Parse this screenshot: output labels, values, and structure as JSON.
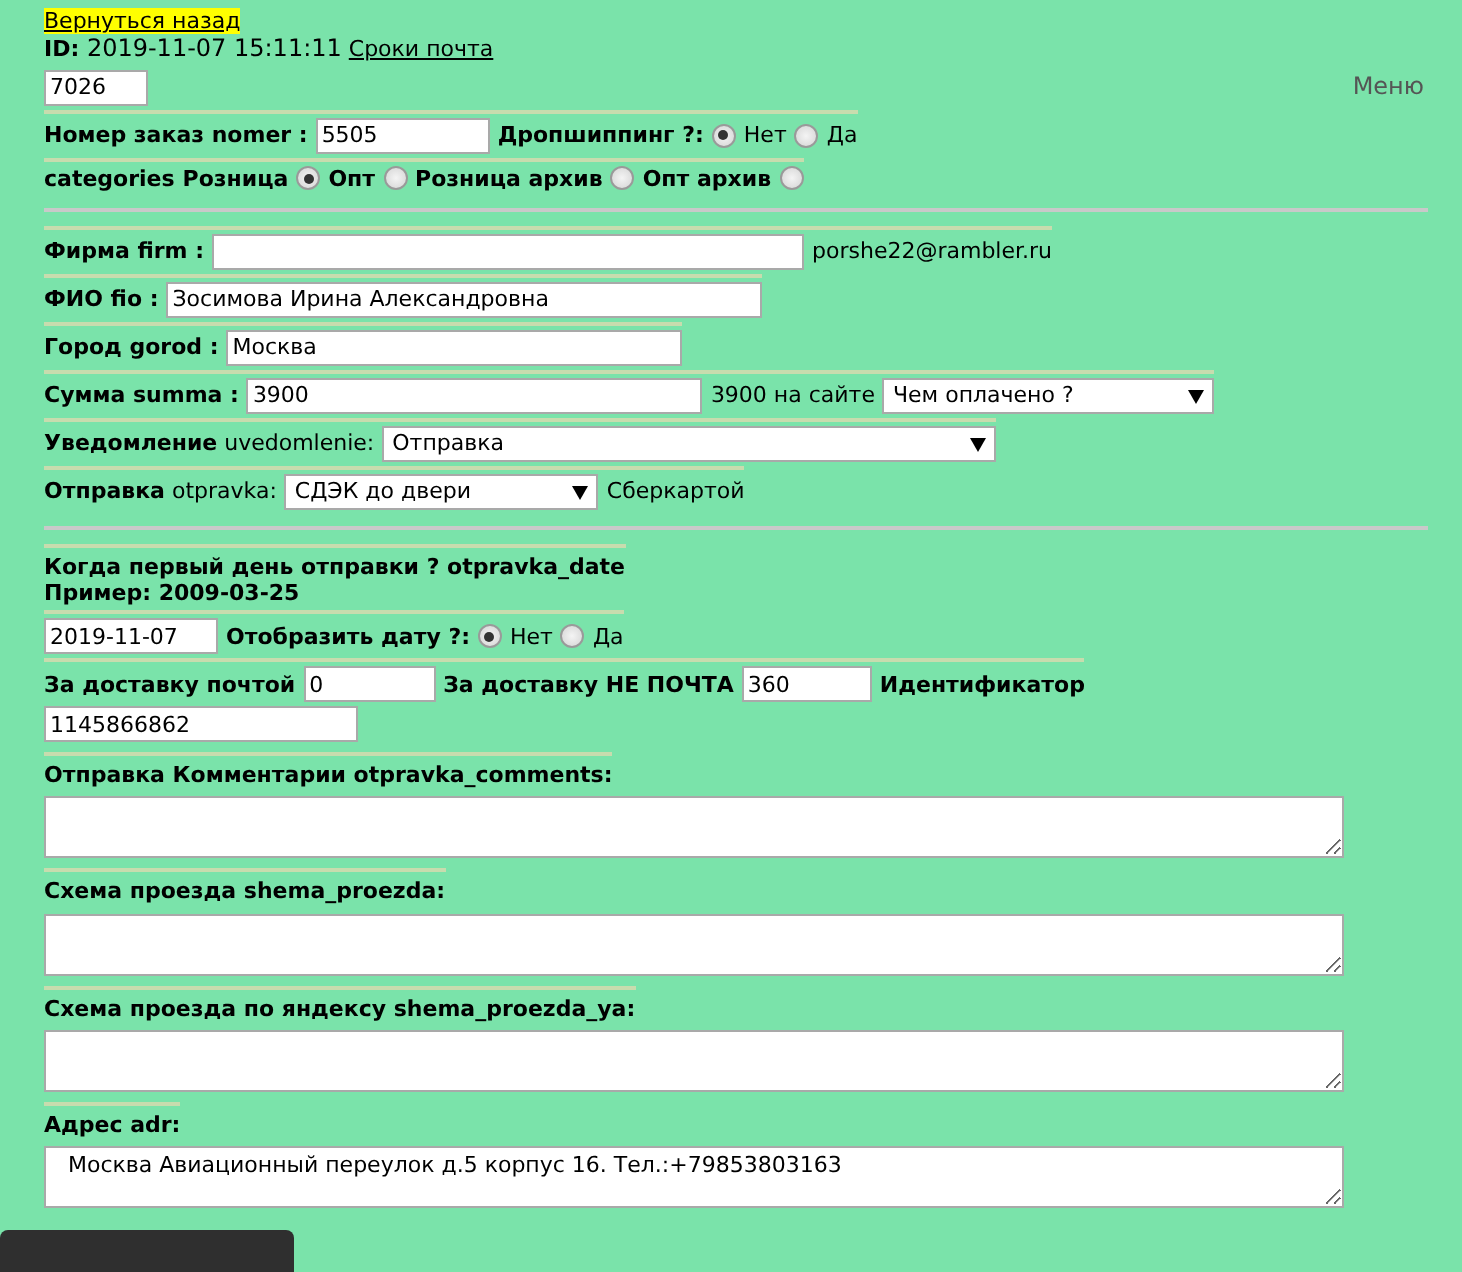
{
  "back_link": "Вернуться назад",
  "header": {
    "id_label": "ID:",
    "id_value": "2019-11-07 15:11:11",
    "link": "Сроки почта"
  },
  "code_field": {
    "value": "7026"
  },
  "menu_link": "Меню",
  "rows": [
    {
      "items": [
        {
          "kind": "label",
          "text": "Номер заказ nomer :"
        },
        {
          "kind": "input",
          "value": "5505"
        },
        {
          "kind": "label",
          "text": "Дропшиппинг ?:"
        },
        {
          "kind": "radio-left",
          "label": "Нет",
          "selected": true
        },
        {
          "kind": "radio-left",
          "label": "Да",
          "selected": false
        }
      ]
    },
    {
      "items": [
        {
          "kind": "label",
          "text": "categories"
        },
        {
          "kind": "radio-right",
          "label": "Розница",
          "selected": true
        },
        {
          "kind": "radio-right",
          "label": "Опт",
          "selected": false
        },
        {
          "kind": "radio-right",
          "label": "Розница архив",
          "selected": false
        },
        {
          "kind": "radio-right",
          "label": "Опт архив",
          "selected": false
        }
      ]
    },
    {
      "kind": "hr"
    },
    {
      "items": [
        {
          "kind": "label",
          "text": "Фирма firm :"
        },
        {
          "kind": "input",
          "value": ""
        },
        {
          "kind": "text",
          "text": "porshe22@rambler.ru"
        }
      ]
    },
    {
      "items": [
        {
          "kind": "label",
          "text": "ФИО fio :"
        },
        {
          "kind": "input",
          "value": "Зосимова Ирина Александровна"
        }
      ]
    },
    {
      "items": [
        {
          "kind": "label",
          "text": "Город gorod :"
        },
        {
          "kind": "input",
          "value": "Москва"
        }
      ]
    },
    {
      "items": [
        {
          "kind": "label",
          "text": "Сумма summa :"
        },
        {
          "kind": "input",
          "value": "3900"
        },
        {
          "kind": "text",
          "text": "3900 на сайте"
        },
        {
          "kind": "select",
          "value": "Чем оплачено ?"
        }
      ]
    },
    {
      "items": [
        {
          "kind": "label",
          "text": "**Уведомление** uvedomlenie:"
        },
        {
          "kind": "select",
          "value": "Отправка"
        }
      ]
    },
    {
      "items": [
        {
          "kind": "label",
          "text": "**Отправка** otpravka:"
        },
        {
          "kind": "select",
          "value": "СДЭК до двери"
        },
        {
          "kind": "text",
          "text": "Сберкартой"
        }
      ]
    },
    {
      "kind": "hr"
    },
    {
      "items": [
        {
          "kind": "heading",
          "text": "Когда первый день отправки ? otpravka_date"
        },
        {
          "kind": "heading",
          "text": "Пример: 2009-03-25"
        }
      ]
    },
    {
      "items": [
        {
          "kind": "input",
          "value": "2019-11-07"
        },
        {
          "kind": "label",
          "text": "Отобразить дату ?:"
        },
        {
          "kind": "radio-left",
          "label": "Нет",
          "selected": true
        },
        {
          "kind": "radio-left",
          "label": "Да",
          "selected": false
        }
      ]
    },
    {
      "items": [
        {
          "kind": "label",
          "text": "За доставку почтой"
        },
        {
          "kind": "input",
          "value": "0"
        },
        {
          "kind": "label",
          "text": "За доставку НЕ ПОЧТА"
        },
        {
          "kind": "input",
          "value": "360"
        },
        {
          "kind": "label",
          "text": "Идентификатор"
        }
      ]
    },
    {
      "items": [
        {
          "kind": "input",
          "value": "1145866862"
        }
      ]
    },
    {
      "items": [
        {
          "kind": "heading",
          "text": "Отправка Комментарии otpravka_comments:"
        },
        {
          "kind": "textarea",
          "value": ""
        }
      ]
    },
    {
      "items": [
        {
          "kind": "heading",
          "text": "Схема проезда shema_proezda:"
        },
        {
          "kind": "textarea",
          "value": ""
        }
      ]
    },
    {
      "items": [
        {
          "kind": "heading",
          "text": "Схема проезда по яндексу shema_proezda_ya:"
        },
        {
          "kind": "textarea",
          "value": ""
        }
      ]
    },
    {
      "items": [
        {
          "kind": "heading",
          "text": "Адрес adr:"
        },
        {
          "kind": "textarea",
          "value": "  Москва Авиационный переулок д.5 корпус 16. Тел.:+79853803163"
        }
      ]
    }
  ]
}
